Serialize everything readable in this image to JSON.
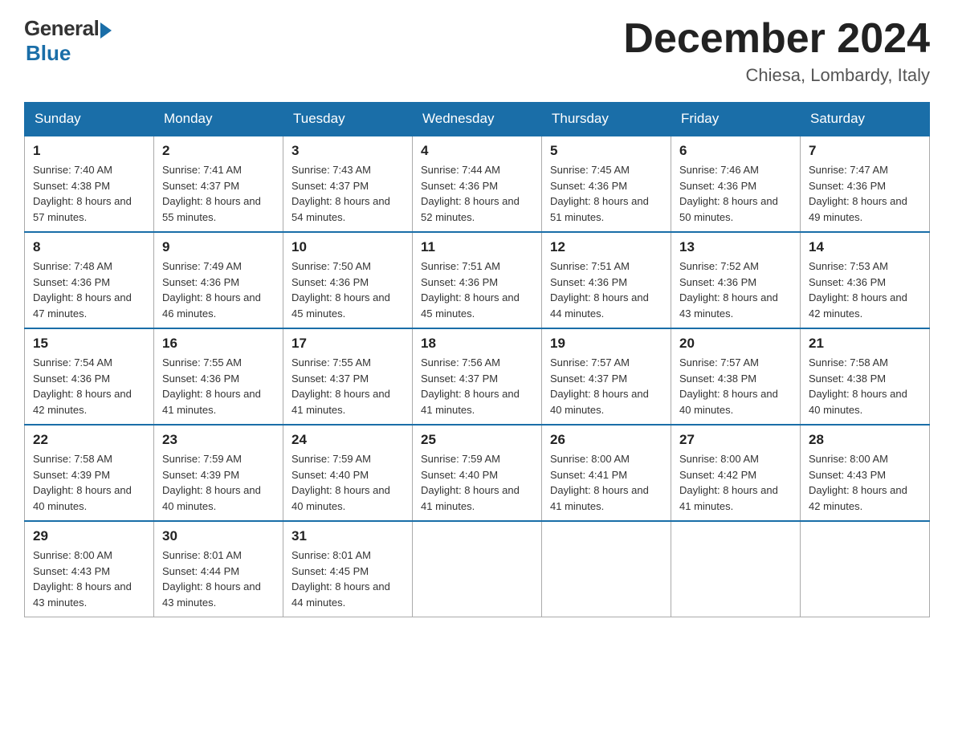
{
  "header": {
    "logo_general": "General",
    "logo_blue": "Blue",
    "month_title": "December 2024",
    "location": "Chiesa, Lombardy, Italy"
  },
  "days_of_week": [
    "Sunday",
    "Monday",
    "Tuesday",
    "Wednesday",
    "Thursday",
    "Friday",
    "Saturday"
  ],
  "weeks": [
    [
      {
        "day": "1",
        "sunrise": "7:40 AM",
        "sunset": "4:38 PM",
        "daylight": "8 hours and 57 minutes."
      },
      {
        "day": "2",
        "sunrise": "7:41 AM",
        "sunset": "4:37 PM",
        "daylight": "8 hours and 55 minutes."
      },
      {
        "day": "3",
        "sunrise": "7:43 AM",
        "sunset": "4:37 PM",
        "daylight": "8 hours and 54 minutes."
      },
      {
        "day": "4",
        "sunrise": "7:44 AM",
        "sunset": "4:36 PM",
        "daylight": "8 hours and 52 minutes."
      },
      {
        "day": "5",
        "sunrise": "7:45 AM",
        "sunset": "4:36 PM",
        "daylight": "8 hours and 51 minutes."
      },
      {
        "day": "6",
        "sunrise": "7:46 AM",
        "sunset": "4:36 PM",
        "daylight": "8 hours and 50 minutes."
      },
      {
        "day": "7",
        "sunrise": "7:47 AM",
        "sunset": "4:36 PM",
        "daylight": "8 hours and 49 minutes."
      }
    ],
    [
      {
        "day": "8",
        "sunrise": "7:48 AM",
        "sunset": "4:36 PM",
        "daylight": "8 hours and 47 minutes."
      },
      {
        "day": "9",
        "sunrise": "7:49 AM",
        "sunset": "4:36 PM",
        "daylight": "8 hours and 46 minutes."
      },
      {
        "day": "10",
        "sunrise": "7:50 AM",
        "sunset": "4:36 PM",
        "daylight": "8 hours and 45 minutes."
      },
      {
        "day": "11",
        "sunrise": "7:51 AM",
        "sunset": "4:36 PM",
        "daylight": "8 hours and 45 minutes."
      },
      {
        "day": "12",
        "sunrise": "7:51 AM",
        "sunset": "4:36 PM",
        "daylight": "8 hours and 44 minutes."
      },
      {
        "day": "13",
        "sunrise": "7:52 AM",
        "sunset": "4:36 PM",
        "daylight": "8 hours and 43 minutes."
      },
      {
        "day": "14",
        "sunrise": "7:53 AM",
        "sunset": "4:36 PM",
        "daylight": "8 hours and 42 minutes."
      }
    ],
    [
      {
        "day": "15",
        "sunrise": "7:54 AM",
        "sunset": "4:36 PM",
        "daylight": "8 hours and 42 minutes."
      },
      {
        "day": "16",
        "sunrise": "7:55 AM",
        "sunset": "4:36 PM",
        "daylight": "8 hours and 41 minutes."
      },
      {
        "day": "17",
        "sunrise": "7:55 AM",
        "sunset": "4:37 PM",
        "daylight": "8 hours and 41 minutes."
      },
      {
        "day": "18",
        "sunrise": "7:56 AM",
        "sunset": "4:37 PM",
        "daylight": "8 hours and 41 minutes."
      },
      {
        "day": "19",
        "sunrise": "7:57 AM",
        "sunset": "4:37 PM",
        "daylight": "8 hours and 40 minutes."
      },
      {
        "day": "20",
        "sunrise": "7:57 AM",
        "sunset": "4:38 PM",
        "daylight": "8 hours and 40 minutes."
      },
      {
        "day": "21",
        "sunrise": "7:58 AM",
        "sunset": "4:38 PM",
        "daylight": "8 hours and 40 minutes."
      }
    ],
    [
      {
        "day": "22",
        "sunrise": "7:58 AM",
        "sunset": "4:39 PM",
        "daylight": "8 hours and 40 minutes."
      },
      {
        "day": "23",
        "sunrise": "7:59 AM",
        "sunset": "4:39 PM",
        "daylight": "8 hours and 40 minutes."
      },
      {
        "day": "24",
        "sunrise": "7:59 AM",
        "sunset": "4:40 PM",
        "daylight": "8 hours and 40 minutes."
      },
      {
        "day": "25",
        "sunrise": "7:59 AM",
        "sunset": "4:40 PM",
        "daylight": "8 hours and 41 minutes."
      },
      {
        "day": "26",
        "sunrise": "8:00 AM",
        "sunset": "4:41 PM",
        "daylight": "8 hours and 41 minutes."
      },
      {
        "day": "27",
        "sunrise": "8:00 AM",
        "sunset": "4:42 PM",
        "daylight": "8 hours and 41 minutes."
      },
      {
        "day": "28",
        "sunrise": "8:00 AM",
        "sunset": "4:43 PM",
        "daylight": "8 hours and 42 minutes."
      }
    ],
    [
      {
        "day": "29",
        "sunrise": "8:00 AM",
        "sunset": "4:43 PM",
        "daylight": "8 hours and 43 minutes."
      },
      {
        "day": "30",
        "sunrise": "8:01 AM",
        "sunset": "4:44 PM",
        "daylight": "8 hours and 43 minutes."
      },
      {
        "day": "31",
        "sunrise": "8:01 AM",
        "sunset": "4:45 PM",
        "daylight": "8 hours and 44 minutes."
      },
      null,
      null,
      null,
      null
    ]
  ]
}
